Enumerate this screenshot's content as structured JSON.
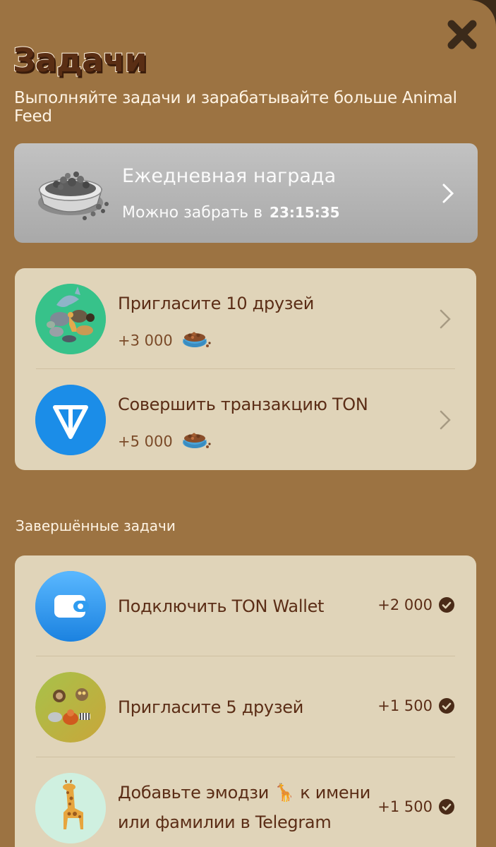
{
  "header": {
    "title": "Задачи",
    "subtitle": "Выполняйте задачи и зарабатывайте больше Animal Feed",
    "close_icon": "close-icon"
  },
  "daily": {
    "title": "Ежедневная награда",
    "claim_label": "Можно забрать в",
    "claim_time": "23:15:35",
    "icon": "pet-food-bowl-icon"
  },
  "tasks": [
    {
      "title": "Пригласите 10 друзей",
      "reward": "+3 000",
      "icon": "animals-group-icon"
    },
    {
      "title": "Совершить транзакцию TON",
      "reward": "+5 000",
      "icon": "ton-logo-icon"
    }
  ],
  "completed": {
    "label": "Завершённые задачи",
    "items": [
      {
        "title": "Подключить TON Wallet",
        "reward": "+2 000",
        "icon": "wallet-icon"
      },
      {
        "title": "Пригласите 5 друзей",
        "reward": "+1 500",
        "icon": "animals-small-group-icon"
      },
      {
        "title_line1": "Добавьте эмодзи 🦒 к имени",
        "title_line2": "или фамилии в Telegram",
        "reward": "+1 500",
        "icon": "giraffe-icon"
      }
    ]
  },
  "colors": {
    "background": "#9c7342",
    "card": "#e0d4b9",
    "text_dark": "#5b2d16",
    "daily_card": "#b4b4b4"
  }
}
